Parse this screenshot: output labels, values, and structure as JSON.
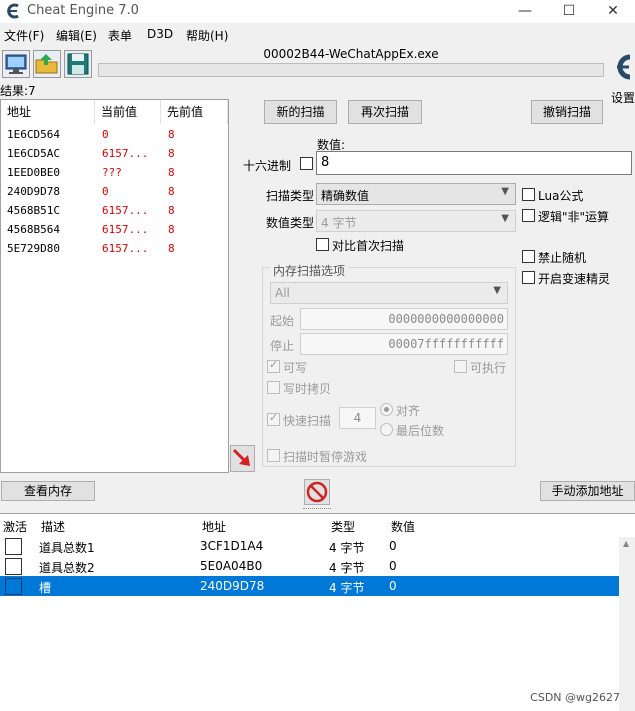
{
  "window": {
    "title": "Cheat Engine 7.0",
    "minimize_glyph": "—",
    "maximize_glyph": "☐",
    "close_glyph": "✕"
  },
  "menu": [
    "文件(F)",
    "编辑(E)",
    "表单",
    "D3D",
    "帮助(H)"
  ],
  "toolbar": {
    "process_title": "00002B44-WeChatAppEx.exe",
    "settings_label": "设置"
  },
  "results": {
    "found_label": "结果:7",
    "headers": [
      "地址",
      "当前值",
      "先前值"
    ],
    "rows": [
      {
        "address": "1E6CD564",
        "current": "0",
        "previous": "8"
      },
      {
        "address": "1E6CD5AC",
        "current": "6157...",
        "previous": "8"
      },
      {
        "address": "1EED0BE0",
        "current": "???",
        "previous": "8"
      },
      {
        "address": "240D9D78",
        "current": "0",
        "previous": "8"
      },
      {
        "address": "4568B51C",
        "current": "6157...",
        "previous": "8"
      },
      {
        "address": "4568B564",
        "current": "6157...",
        "previous": "8"
      },
      {
        "address": "5E729D80",
        "current": "6157...",
        "previous": "8"
      }
    ]
  },
  "scan": {
    "new_scan": "新的扫描",
    "next_scan": "再次扫描",
    "undo_scan": "撤销扫描",
    "value_label": "数值:",
    "hex_label": "十六进制",
    "value": "8",
    "scan_type_label": "扫描类型",
    "scan_type": "精确数值",
    "value_type_label": "数值类型",
    "value_type": "4 字节",
    "compare_first": "对比首次扫描",
    "lua_formula": "Lua公式",
    "logic_not": "逻辑\"非\"运算",
    "no_random": "禁止随机",
    "speedhack": "开启变速精灵"
  },
  "memory_options": {
    "title": "内存扫描选项",
    "region": "All",
    "start_label": "起始",
    "start": "0000000000000000",
    "stop_label": "停止",
    "stop": "00007fffffffffff",
    "writable": "可写",
    "executable": "可执行",
    "copy_on_write": "写时拷贝",
    "fast_scan": "快速扫描",
    "fast_scan_value": "4",
    "alignment": "对齐",
    "last_digits": "最后位数",
    "pause_game": "扫描时暂停游戏"
  },
  "bottom": {
    "view_memory": "查看内存",
    "add_address": "手动添加地址"
  },
  "address_list": {
    "headers": [
      "激活",
      "描述",
      "地址",
      "类型",
      "数值"
    ],
    "rows": [
      {
        "description": "道具总数1",
        "address": "3CF1D1A4",
        "type": "4 字节",
        "value": "0",
        "selected": false
      },
      {
        "description": "道具总数2",
        "address": "5E0A04B0",
        "type": "4 字节",
        "value": "0",
        "selected": false
      },
      {
        "description": "槽",
        "address": "240D9D78",
        "type": "4 字节",
        "value": "0",
        "selected": true
      }
    ]
  },
  "watermark": "CSDN @wg2627",
  "colors": {
    "changed_value": "#e00000",
    "selection": "#0078d7",
    "accent_arrow": "#d42020"
  }
}
